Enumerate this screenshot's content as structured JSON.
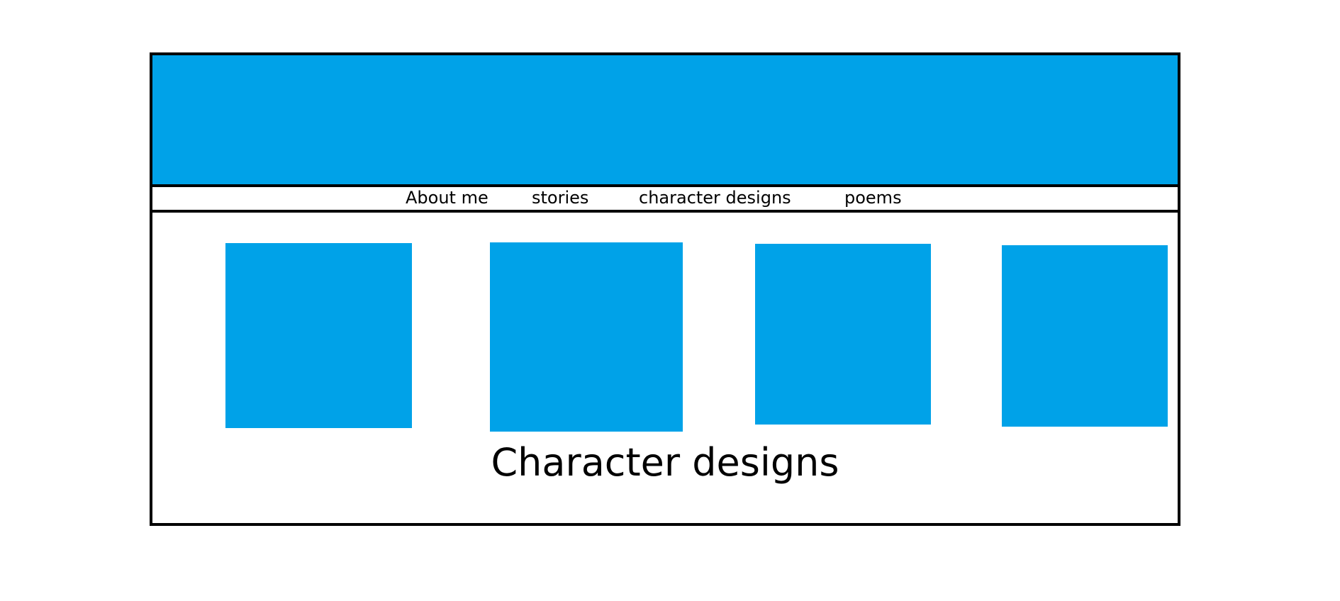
{
  "colors": {
    "accent": "#00a2e8",
    "border": "#000000",
    "background": "#ffffff"
  },
  "nav": {
    "items": [
      {
        "label": "About me"
      },
      {
        "label": "stories"
      },
      {
        "label": "character designs"
      },
      {
        "label": "poems"
      }
    ]
  },
  "main": {
    "heading": "Character designs"
  }
}
